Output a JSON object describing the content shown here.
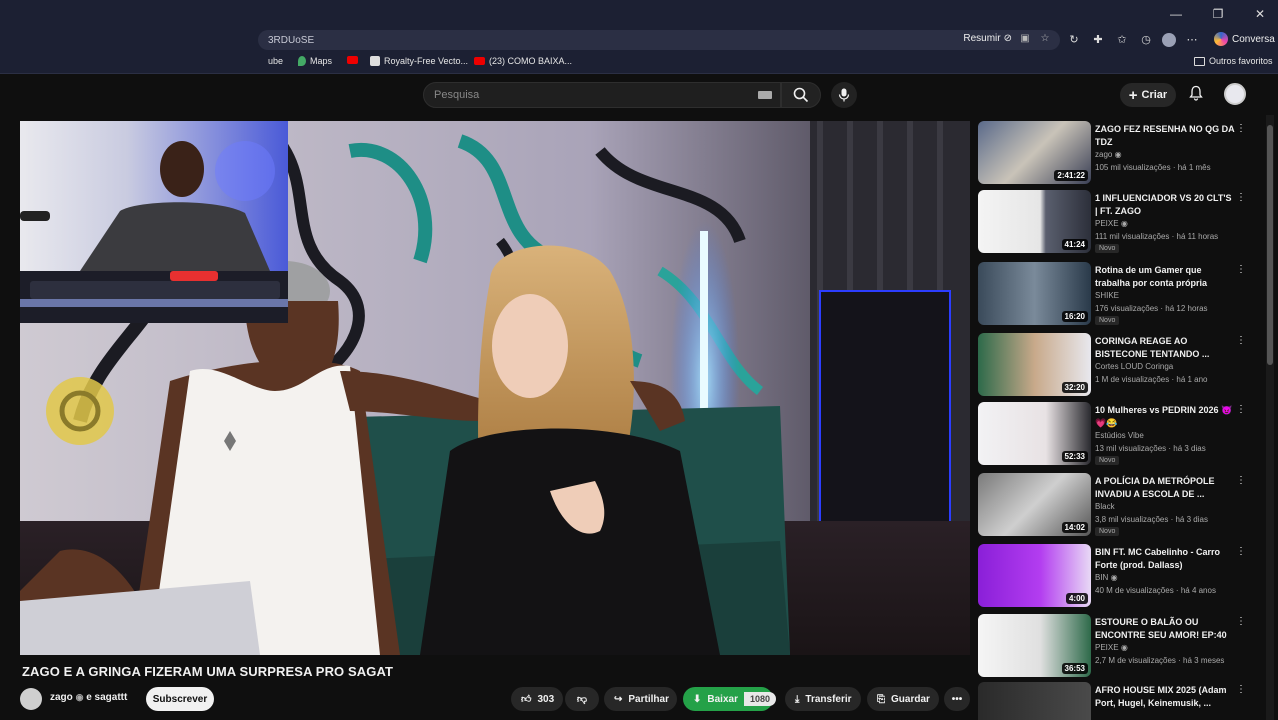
{
  "browser": {
    "url_partial": "3RDUoSE",
    "resumir_label": "Resumir",
    "conversa_label": "Conversa",
    "bookmarks": [
      {
        "label": "ube",
        "icon": "youtube-icon"
      },
      {
        "label": "Maps",
        "icon": "maps-pin-icon"
      },
      {
        "label": "",
        "icon": "youtube-icon"
      },
      {
        "label": "Royalty-Free Vecto...",
        "icon": "royalty-free-icon"
      },
      {
        "label": "(23) COMO BAIXA...",
        "icon": "youtube-icon"
      }
    ],
    "other_favorites": "Outros favoritos"
  },
  "youtube": {
    "search_placeholder": "Pesquisa",
    "create_label": "Criar"
  },
  "video": {
    "title": "ZAGO E A GRINGA FIZERAM UMA SURPRESA PRO SAGAT",
    "channel": "zago",
    "channel_suffix": "e sagattt",
    "subscribe_label": "Subscrever",
    "likes": "303",
    "share_label": "Partilhar",
    "download_label": "Baixar",
    "download_quality": "1080",
    "transfer_label": "Transferir",
    "save_label": "Guardar",
    "more_label": "•••"
  },
  "recommendations": [
    {
      "title": "ZAGO FEZ RESENHA NO QG DA TDZ",
      "channel": "zago",
      "verified": true,
      "meta": "105 mil visualizações · há 1 mês",
      "duration": "2:41:22",
      "badge": ""
    },
    {
      "title": "1 INFLUENCIADOR VS 20 CLT'S | FT. ZAGO",
      "channel": "PEIXE",
      "verified": true,
      "meta": "111 mil visualizações · há 11 horas",
      "duration": "41:24",
      "badge": "Novo"
    },
    {
      "title": "Rotina de um Gamer que trabalha por conta própria",
      "channel": "SHIKE",
      "verified": false,
      "meta": "176 visualizações · há 12 horas",
      "duration": "16:20",
      "badge": "Novo"
    },
    {
      "title": "CORINGA REAGE AO BISTECONE TENTANDO ...",
      "channel": "Cortes LOUD Coringa",
      "verified": false,
      "meta": "1 M de visualizações · há 1 ano",
      "duration": "32:20",
      "badge": ""
    },
    {
      "title": "10 Mulheres vs PEDRIN 2026 😈💗😂",
      "channel": "Estúdios Vibe",
      "verified": false,
      "meta": "13 mil visualizações · há 3 dias",
      "duration": "52:33",
      "badge": "Novo"
    },
    {
      "title": "A POLÍCIA DA METRÓPOLE INVADIU A ESCOLA DE ...",
      "channel": "Black",
      "verified": false,
      "meta": "3,8 mil visualizações · há 3 dias",
      "duration": "14:02",
      "badge": "Novo"
    },
    {
      "title": "BIN FT. MC Cabelinho - Carro Forte (prod. Dallass)",
      "channel": "BIN",
      "verified": true,
      "meta": "40 M de visualizações · há 4 anos",
      "duration": "4:00",
      "badge": ""
    },
    {
      "title": "ESTOURE O BALÃO OU ENCONTRE SEU AMOR! EP:40",
      "channel": "PEIXE",
      "verified": true,
      "meta": "2,7 M de visualizações · há 3 meses",
      "duration": "36:53",
      "badge": ""
    },
    {
      "title": "AFRO HOUSE MIX 2025 (Adam Port, Hugel, Keinemusik, ...",
      "channel": "",
      "verified": false,
      "meta": "",
      "duration": "",
      "badge": ""
    }
  ],
  "colors": {
    "chrome_bg": "#1c2033",
    "yt_bg": "#0f0f0f",
    "download_green": "#24a148"
  }
}
